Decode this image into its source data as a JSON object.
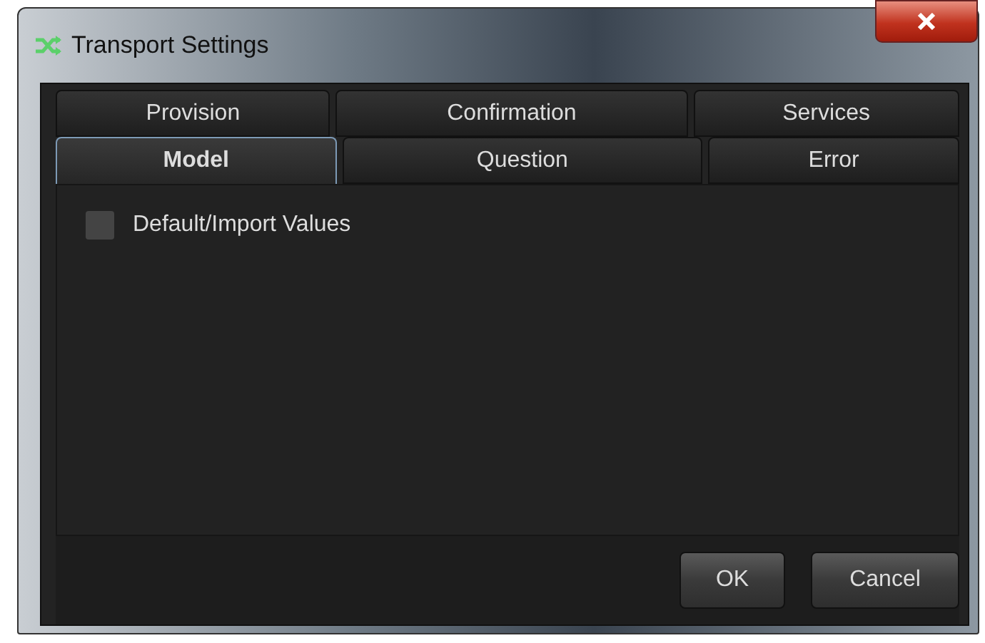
{
  "window": {
    "title": "Transport Settings"
  },
  "tab_rows": [
    [
      {
        "label": "Provision",
        "selected": false
      },
      {
        "label": "Confirmation",
        "selected": false
      },
      {
        "label": "Services",
        "selected": false
      }
    ],
    [
      {
        "label": "Model",
        "selected": true
      },
      {
        "label": "Question",
        "selected": false
      },
      {
        "label": "Error",
        "selected": false
      }
    ]
  ],
  "checkbox": {
    "label": "Default/Import Values",
    "checked": false
  },
  "buttons": [
    "OK",
    "Cancel"
  ]
}
